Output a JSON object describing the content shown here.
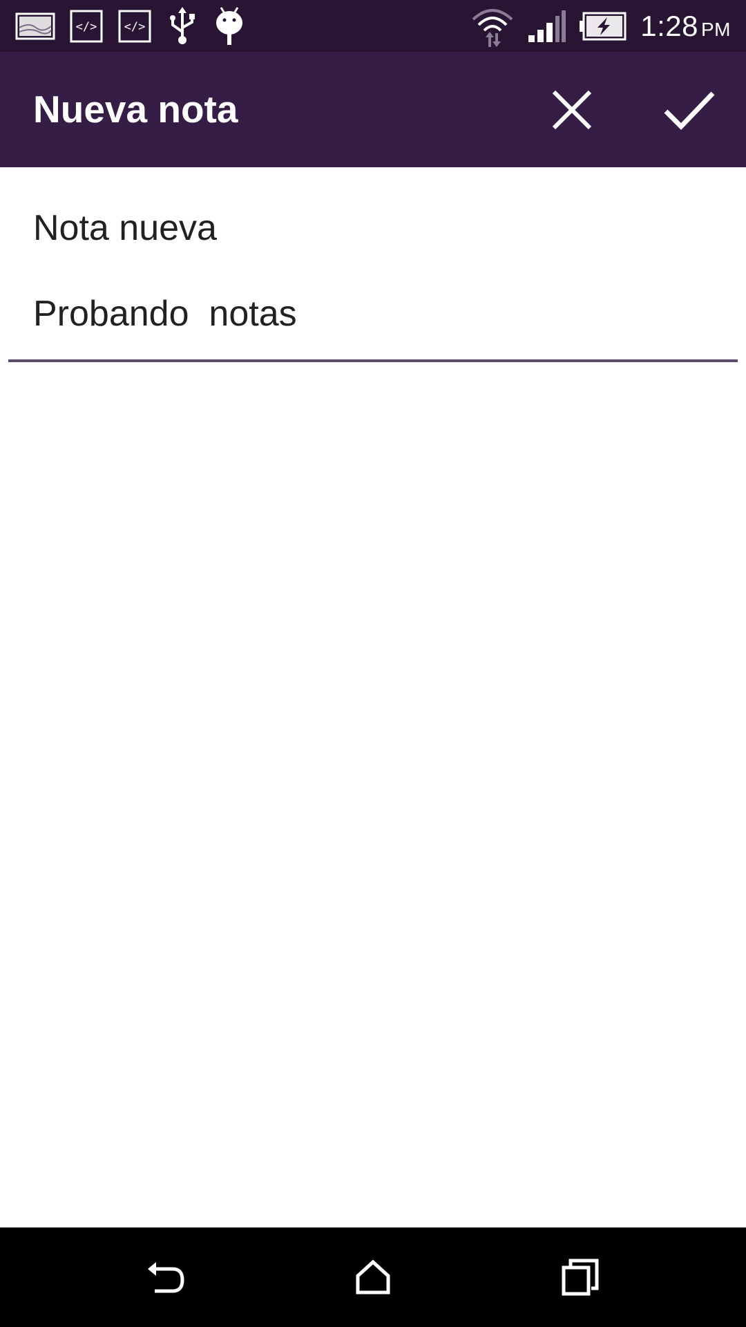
{
  "status_bar": {
    "time": "1:28",
    "ampm": "PM",
    "notification_icons": [
      "image-notification-icon",
      "code-icon",
      "code-icon",
      "usb-icon",
      "android-debug-icon"
    ],
    "system_icons": [
      "wifi-icon",
      "signal-icon",
      "battery-charging-icon"
    ]
  },
  "app_bar": {
    "title": "Nueva nota",
    "close_icon": "close-icon",
    "confirm_icon": "check-icon",
    "background": "#351d45"
  },
  "note": {
    "title_value": "Nota nueva",
    "body_value": "Probando  notas"
  },
  "nav_bar": {
    "icons": [
      "back-icon",
      "home-icon",
      "recents-icon"
    ]
  },
  "colors": {
    "status_bar": "#2a1433",
    "app_bar": "#351d45",
    "underline": "#5d4b6a",
    "text": "#212121"
  }
}
